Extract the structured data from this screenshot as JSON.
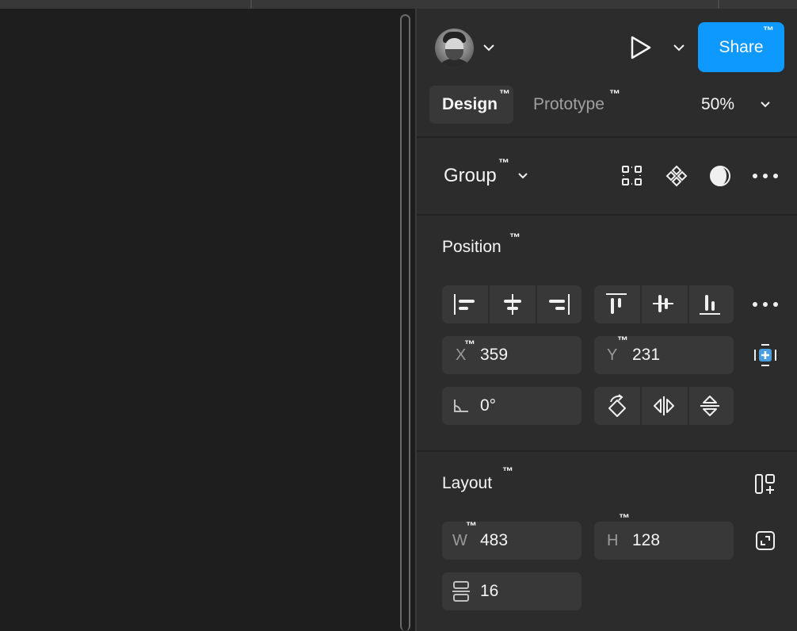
{
  "header": {
    "avatar_name": "avatar",
    "share_label": "Share",
    "tm": "™"
  },
  "tabs": {
    "design": "Design",
    "prototype": "Prototype",
    "zoom": "50%"
  },
  "selection": {
    "type_label": "Group"
  },
  "position": {
    "title": "Position",
    "x_label": "X",
    "x_value": "359",
    "y_label": "Y",
    "y_value": "231",
    "rotation_value": "0°"
  },
  "layout": {
    "title": "Layout",
    "w_label": "W",
    "w_value": "483",
    "h_label": "H",
    "h_value": "128",
    "gap_value": "16"
  },
  "colors": {
    "accent": "#0d99ff",
    "panel": "#2c2c2c",
    "field": "#383838",
    "canvas": "#1e1e1e"
  }
}
